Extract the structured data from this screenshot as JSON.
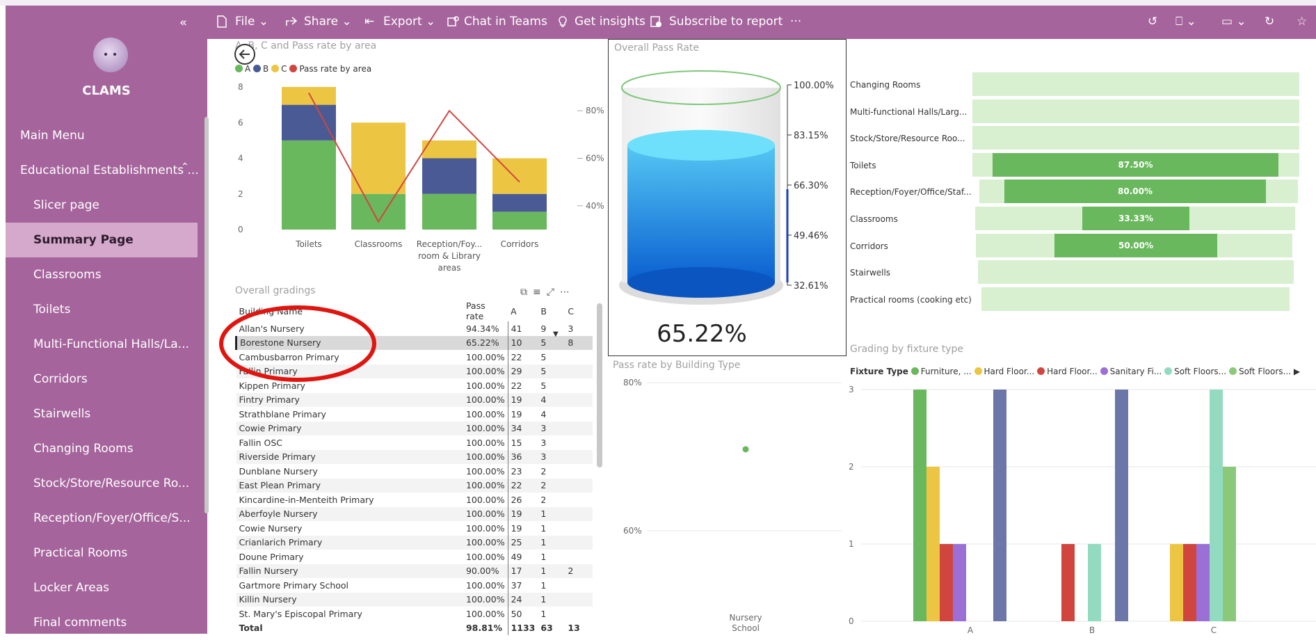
{
  "app": {
    "brand": "CLAMS",
    "collapse_glyph": "«",
    "colors": {
      "sidebar": "#a5649c",
      "active": "#d4a9cc",
      "gradeA": "#6ab85d",
      "gradeB": "#4a5a95",
      "gradeC": "#ecc642",
      "pass_line": "#d0463e"
    }
  },
  "toolbar": {
    "file": "File",
    "share": "Share",
    "export": "Export",
    "teams": "Chat in Teams",
    "insights": "Get insights",
    "subscribe": "Subscribe to report",
    "more": "···"
  },
  "nav": {
    "items": [
      {
        "label": "Main Menu"
      },
      {
        "label": "Educational Establishments ..."
      },
      {
        "label": "Slicer page"
      },
      {
        "label": "Summary Page"
      },
      {
        "label": "Classrooms"
      },
      {
        "label": "Toilets"
      },
      {
        "label": "Multi-Functional Halls/La..."
      },
      {
        "label": "Corridors"
      },
      {
        "label": "Stairwells"
      },
      {
        "label": "Changing Rooms"
      },
      {
        "label": "Stock/Store/Resource Ro..."
      },
      {
        "label": "Reception/Foyer/Office/S..."
      },
      {
        "label": "Practical Rooms"
      },
      {
        "label": "Locker Areas"
      },
      {
        "label": "Final comments"
      }
    ]
  },
  "area_chart": {
    "title": "A, B, C and Pass rate by area",
    "legend": [
      "A",
      "B",
      "C",
      "Pass rate by area"
    ]
  },
  "table": {
    "title": "Overall gradings",
    "headers": [
      "Building Name",
      "Pass rate",
      "A",
      "B",
      "C"
    ],
    "rows": [
      [
        "Allan's Nursery",
        "94.34%",
        "41",
        "9",
        "3"
      ],
      [
        "Borestone Nursery",
        "65.22%",
        "10",
        "5",
        "8"
      ],
      [
        "Cambusbarron Primary",
        "100.00%",
        "22",
        "5",
        ""
      ],
      [
        "Fallin Primary",
        "100.00%",
        "29",
        "5",
        ""
      ],
      [
        "Kippen Primary",
        "100.00%",
        "22",
        "5",
        ""
      ],
      [
        "Fintry Primary",
        "100.00%",
        "19",
        "4",
        ""
      ],
      [
        "Strathblane Primary",
        "100.00%",
        "19",
        "4",
        ""
      ],
      [
        "Cowie Primary",
        "100.00%",
        "34",
        "3",
        ""
      ],
      [
        "Fallin OSC",
        "100.00%",
        "15",
        "3",
        ""
      ],
      [
        "Riverside Primary",
        "100.00%",
        "36",
        "3",
        ""
      ],
      [
        "Dunblane Nursery",
        "100.00%",
        "23",
        "2",
        ""
      ],
      [
        "East Plean Primary",
        "100.00%",
        "22",
        "2",
        ""
      ],
      [
        "Kincardine-in-Menteith Primary",
        "100.00%",
        "26",
        "2",
        ""
      ],
      [
        "Aberfoyle Nursery",
        "100.00%",
        "19",
        "1",
        ""
      ],
      [
        "Cowie Nursery",
        "100.00%",
        "19",
        "1",
        ""
      ],
      [
        "Crianlarich Primary",
        "100.00%",
        "25",
        "1",
        ""
      ],
      [
        "Doune Primary",
        "100.00%",
        "49",
        "1",
        ""
      ],
      [
        "Fallin Nursery",
        "90.00%",
        "17",
        "1",
        "2"
      ],
      [
        "Gartmore Primary School",
        "100.00%",
        "37",
        "1",
        ""
      ],
      [
        "Killin Nursery",
        "100.00%",
        "24",
        "1",
        ""
      ],
      [
        "St. Mary's Episcopal Primary",
        "100.00%",
        "50",
        "1",
        ""
      ]
    ],
    "total": [
      "Total",
      "98.81%",
      "1133",
      "63",
      "13"
    ]
  },
  "gauge": {
    "title": "Overall Pass Rate",
    "value": "65.22%",
    "fill": 0.49,
    "ticks": [
      "100.00%",
      "83.15%",
      "66.30%",
      "49.46%",
      "32.61%"
    ]
  },
  "funnel": {
    "rows": [
      {
        "label": "Changing Rooms",
        "bar": ""
      },
      {
        "label": "Multi-functional Halls/Larg...",
        "bar": ""
      },
      {
        "label": "Stock/Store/Resource Roo...",
        "bar": ""
      },
      {
        "label": "Toilets",
        "bar": "87.50%"
      },
      {
        "label": "Reception/Foyer/Office/Staf...",
        "bar": "80.00%"
      },
      {
        "label": "Classrooms",
        "bar": "33.33%"
      },
      {
        "label": "Corridors",
        "bar": "50.00%"
      },
      {
        "label": "Stairwells",
        "bar": ""
      },
      {
        "label": "Practical rooms (cooking etc)",
        "bar": ""
      }
    ]
  },
  "building_type": {
    "title": "Pass rate by Building Type",
    "category": "Nursery School"
  },
  "fixture": {
    "title": "Grading by fixture type",
    "legend_title": "Fixture Type",
    "legend": [
      "Furniture, ...",
      "Hard Floor...",
      "Hard Floor...",
      "Sanitary Fi...",
      "Soft Floors...",
      "Soft Floors..."
    ]
  },
  "chart_data": [
    {
      "type": "bar",
      "title": "A, B, C and Pass rate by area",
      "categories": [
        "Toilets",
        "Classrooms",
        "Reception/Foyer room & Library areas",
        "Corridors"
      ],
      "ylim": [
        0,
        8
      ],
      "y2lim": [
        30,
        90
      ],
      "yticks": [
        "0",
        "2",
        "4",
        "6",
        "8"
      ],
      "y2ticks": [
        "40%",
        "60%",
        "80%"
      ],
      "series": [
        {
          "name": "A",
          "values": [
            5,
            2,
            2,
            1
          ]
        },
        {
          "name": "B",
          "values": [
            2,
            0,
            2,
            1
          ]
        },
        {
          "name": "C",
          "values": [
            1,
            4,
            1,
            2
          ]
        },
        {
          "name": "Pass rate by area",
          "values": [
            87.5,
            33.33,
            80.0,
            50.0
          ]
        }
      ]
    },
    {
      "type": "scatter",
      "title": "Pass rate by Building Type",
      "categories": [
        "Nursery School"
      ],
      "ylim": [
        55,
        82
      ],
      "yticks": [
        "60%",
        "80%"
      ],
      "values": [
        71
      ]
    },
    {
      "type": "bar",
      "title": "Grading by fixture type",
      "categories": [
        "A",
        "B",
        "C"
      ],
      "ylim": [
        0,
        3
      ],
      "yticks": [
        "0",
        "1",
        "2",
        "3"
      ],
      "series": [
        {
          "name": "Furniture, ...",
          "values": [
            3,
            0,
            0
          ]
        },
        {
          "name": "Hard Floor...",
          "values": [
            2,
            0,
            1
          ]
        },
        {
          "name": "Hard Floor...",
          "values": [
            1,
            1,
            1
          ]
        },
        {
          "name": "Sanitary Fi...",
          "values": [
            1,
            0,
            1
          ]
        },
        {
          "name": "Soft Floors...",
          "values": [
            0,
            1,
            3
          ]
        },
        {
          "name": "Soft Floors...",
          "values": [
            0,
            0,
            2
          ]
        },
        {
          "name": "",
          "values": [
            3,
            3,
            0
          ]
        }
      ]
    }
  ]
}
